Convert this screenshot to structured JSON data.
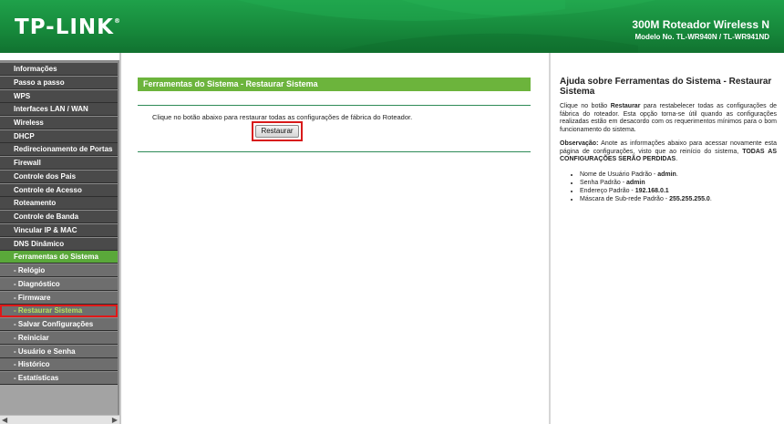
{
  "header": {
    "brand": "TP-LINK",
    "brand_mark": "®",
    "model_title": "300M Roteador Wireless N",
    "model_number": "Modelo No. TL-WR940N / TL-WR941ND"
  },
  "menu": {
    "items": [
      {
        "label": "Informações"
      },
      {
        "label": "Passo a passo"
      },
      {
        "label": "WPS"
      },
      {
        "label": "Interfaces LAN / WAN"
      },
      {
        "label": "Wireless"
      },
      {
        "label": "DHCP"
      },
      {
        "label": "Redirecionamento de Portas"
      },
      {
        "label": "Firewall"
      },
      {
        "label": "Controle dos Pais"
      },
      {
        "label": "Controle de Acesso"
      },
      {
        "label": "Roteamento"
      },
      {
        "label": "Controle de Banda"
      },
      {
        "label": "Vincular IP & MAC"
      },
      {
        "label": "DNS Dinâmico"
      },
      {
        "label": "Ferramentas do Sistema"
      },
      {
        "label": "- Relógio"
      },
      {
        "label": "- Diagnóstico"
      },
      {
        "label": "- Firmware"
      },
      {
        "label": "- Restaurar Sistema"
      },
      {
        "label": "- Salvar Configurações"
      },
      {
        "label": "- Reiniciar"
      },
      {
        "label": "- Usuário e Senha"
      },
      {
        "label": "- Histórico"
      },
      {
        "label": "- Estatísticas"
      }
    ]
  },
  "main": {
    "section_title": "Ferramentas do Sistema - Restaurar Sistema",
    "description": "Clique no botão abaixo para restaurar todas as configurações de fábrica do Roteador.",
    "restore_button": "Restaurar"
  },
  "help": {
    "title": "Ajuda sobre Ferramentas do Sistema - Restaurar Sistema",
    "p1_before": "Clique no botão ",
    "p1_bold": "Restaurar",
    "p1_after": " para restabelecer todas as configurações de fábrica do roteador. Esta opção torna-se útil quando as configurações realizadas estão em desacordo com os requerimentos mínimos para o bom funcionamento do sistema.",
    "p2_label": "Observação:",
    "p2_text": " Anote as informações abaixo para acessar novamente esta página de configurações, visto que ao reinício do sistema, ",
    "p2_bold": "TODAS AS CONFIGURAÇÕES SERÃO PERDIDAS",
    "p2_end": ".",
    "defaults": [
      {
        "label": "Nome de Usuário Padrão - ",
        "value": "admin",
        "end": "."
      },
      {
        "label": "Senha Padrão - ",
        "value": "admin",
        "end": ""
      },
      {
        "label": "Endereço Padrão - ",
        "value": "192.168.0.1",
        "end": ""
      },
      {
        "label": "Máscara de Sub-rede Padrão - ",
        "value": "255.255.255.0",
        "end": "."
      }
    ]
  },
  "colors": {
    "header_green": "#178a3c",
    "active_green": "#5aa83a",
    "menu_dark": "#4a4a4a",
    "highlight_red": "#d81a1a"
  }
}
